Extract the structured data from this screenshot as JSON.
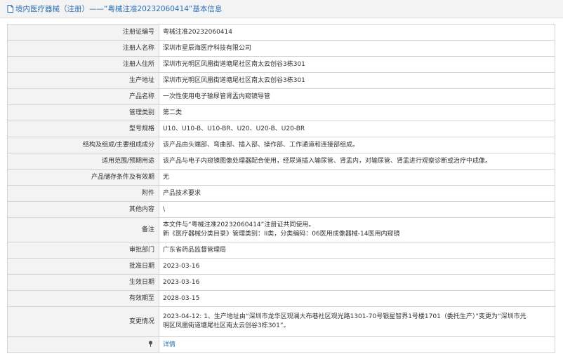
{
  "header": {
    "prefix": "境内医疗器械（注册）",
    "separator": "——",
    "title": "“粤械注准20232060414”基本信息"
  },
  "rows": [
    {
      "label": "注册证编号",
      "value": "粤械注准20232060414"
    },
    {
      "label": "注册人名称",
      "value": "深圳市星辰海医疗科技有限公司"
    },
    {
      "label": "注册人住所",
      "value": "深圳市光明区凤凰街道塘尾社区南太云创谷3栋301"
    },
    {
      "label": "生产地址",
      "value": "深圳市光明区凤凰街道塘尾社区南太云创谷3栋301"
    },
    {
      "label": "产品名称",
      "value": "一次性使用电子输尿管肾盂内窥镜导管"
    },
    {
      "label": "管理类别",
      "value": "第二类"
    },
    {
      "label": "型号规格",
      "value": "U10、U10-B、U10-BR、U20、U20-B、U20-BR"
    },
    {
      "label": "结构及组成/主要组成成分",
      "value": "该产品由头端部、弯曲部、插入部、操作部、工作通道和连接部组成。"
    },
    {
      "label": "适用范围/预期用途",
      "value": "该产品与电子内窥镜图像处理器配合使用，经尿道插入输尿管、肾盂内，对输尿管、肾盂进行观察诊断或治疗中成像。"
    },
    {
      "label": "产品储存条件及有效期",
      "value": "无"
    },
    {
      "label": "附件",
      "value": "产品技术要求"
    },
    {
      "label": "其他内容",
      "value": "\\"
    }
  ],
  "remarks": {
    "label": "备注",
    "line1": "本文件与“粤械注准20232060414”注册证共同使用。",
    "line2": "新《医疗器械分类目录》管理类别：II类，分类编码：06医用成像器械-14医用内窥镜"
  },
  "rows2": [
    {
      "label": "审批部门",
      "value": "广东省药品监督管理局"
    },
    {
      "label": "批准日期",
      "value": "2023-03-16"
    },
    {
      "label": "生效日期",
      "value": "2023-03-16"
    },
    {
      "label": "有效期至",
      "value": "2028-03-15"
    }
  ],
  "changes": {
    "label": "变更情况",
    "line1": "2023-04-12: 1、生产地址由“深圳市龙华区观澜大布巷社区观光路1301-70号银星智界1号楼1701（委托生产）”变更为“深圳市光",
    "line2": "明区凤凰街道塘尾社区南太云创谷3栋301”。"
  },
  "footer": {
    "link_label": "详情",
    "pin_icon": "pin-icon"
  },
  "colors": {
    "accent": "#2a6fb5",
    "label_bg": "#f3f3f3",
    "border": "#d4d4d4"
  }
}
